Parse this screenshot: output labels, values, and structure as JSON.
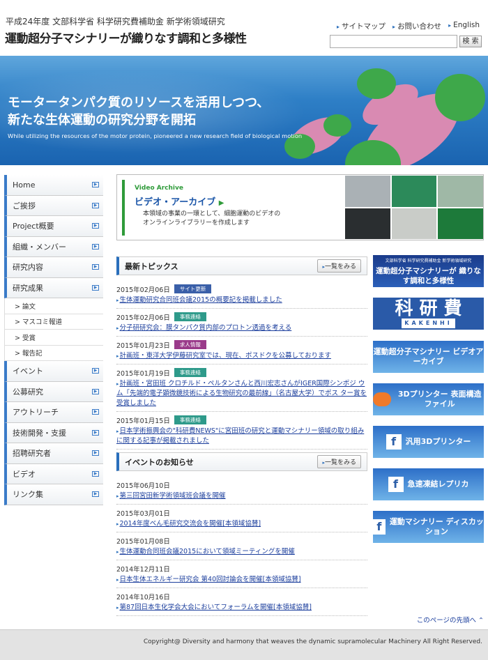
{
  "header": {
    "subtitle": "平成24年度 文部科学省 科学研究費補助金 新学術領域研究",
    "title": "運動超分子マシナリーが織りなす調和と多様性",
    "links": [
      "サイトマップ",
      "お問い合わせ",
      "English"
    ],
    "search_placeholder": "",
    "search_button": "検 索"
  },
  "hero": {
    "line1": "モータータンパク質のリソースを活用しつつ、",
    "line2": "新たな生体運動の研究分野を開拓",
    "english": "While utilizing the resources of the motor protein, pioneered a new research field of biological motion"
  },
  "sidebar": {
    "items": [
      {
        "label": "Home"
      },
      {
        "label": "ご挨拶"
      },
      {
        "label": "Project概要"
      },
      {
        "label": "組織・メンバー"
      },
      {
        "label": "研究内容"
      },
      {
        "label": "研究成果"
      }
    ],
    "subitems": [
      "> 論文",
      "> マスコミ報道",
      "> 受賞",
      "> 報告記"
    ],
    "items2": [
      {
        "label": "イベント"
      },
      {
        "label": "公募研究"
      },
      {
        "label": "アウトリーチ"
      },
      {
        "label": "技術開発・支援"
      },
      {
        "label": "招聘研究者"
      },
      {
        "label": "ビデオ"
      },
      {
        "label": "リンク集"
      }
    ]
  },
  "video_banner": {
    "label": "Video Archive",
    "title": "ビデオ・アーカイブ",
    "desc1": "本領域の事業の一環として、細胞運動のビデオの",
    "desc2": "オンラインライブラリーを作成します"
  },
  "topics": {
    "title": "最新トピックス",
    "more": "一覧をみる",
    "items": [
      {
        "date": "2015年02月06日",
        "badge": "サイト更新",
        "badge_color": "#3a5fa8",
        "text": "生体運動研究合同班会議2015の概要記を掲載しました"
      },
      {
        "date": "2015年02月06日",
        "badge": "事務連絡",
        "badge_color": "#2e9a8a",
        "text": "分子研研究会：膜タンパク質内部のプロトン透過を考える"
      },
      {
        "date": "2015年01月23日",
        "badge": "求人情報",
        "badge_color": "#9a3a8a",
        "text": "計画班・東洋大学伊藤研究室では、現在、ポスドクを公募しております"
      },
      {
        "date": "2015年01月19日",
        "badge": "事務連絡",
        "badge_color": "#2e9a8a",
        "text": "計画班・宮田班 クロチルド・ペルタンさんと西川宏志さんがIGER国際シンポジ ウム「先端的電子顕微鏡技術による生物研究の最前線」（名古屋大学）でポス ター賞を受賞しました"
      },
      {
        "date": "2015年01月15日",
        "badge": "事務連絡",
        "badge_color": "#2e9a8a",
        "text": "日本学術振興会の\"科研費NEWS\"に宮田班の研究と運動マシナリー領域の取り組み に関する記事が掲載されました"
      }
    ]
  },
  "events": {
    "title": "イベントのお知らせ",
    "more": "一覧をみる",
    "items": [
      {
        "date": "2015年06月10日",
        "text": "第三回宮田新学術領域班会議を開催"
      },
      {
        "date": "2015年03月01日",
        "text": "2014年度べん毛研究交流会を開催[本領域協賛]"
      },
      {
        "date": "2015年01月08日",
        "text": "生体運動合同班会議2015において領域ミーティングを開催"
      },
      {
        "date": "2014年12月11日",
        "text": "日本生体エネルギー研究会 第40回討論会を開催[本領域協賛]"
      },
      {
        "date": "2014年10月16日",
        "text": "第87回日本生化学会大会においてフォーラムを開催[本領域協賛]"
      }
    ]
  },
  "right_banners": [
    {
      "text": "運動超分子マシナリーが 織りなす調和と多様性",
      "small": "文部科学省 科学研究費補助金 新学術領域研究"
    },
    {
      "text": "科 研 費",
      "small": "KAKENHI"
    },
    {
      "text": "運動超分子マシナリー ビデオアーカイブ",
      "small": ""
    },
    {
      "text": "3Dプリンター 表面構造ファイル",
      "small": ""
    },
    {
      "text": "汎用3Dプリンター",
      "small": ""
    },
    {
      "text": "急速凍結レプリカ",
      "small": ""
    },
    {
      "text": "運動マシナリー ディスカッション",
      "small": ""
    }
  ],
  "pagetop": "このページの先頭へ",
  "copyright": "Copyright@ Diversity and harmony that weaves the dynamic supramolecular Machinery All Right Reserved."
}
